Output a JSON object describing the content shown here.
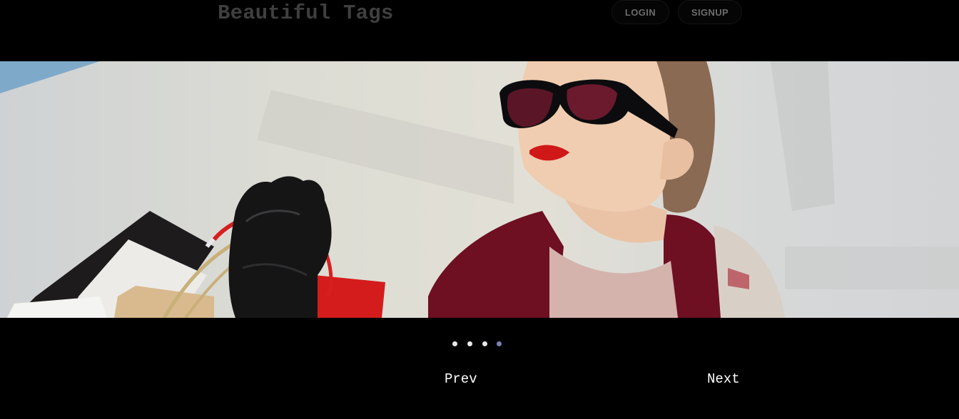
{
  "header": {
    "brand": "Beautiful Tags",
    "login_label": "LOGIN",
    "signup_label": "SIGNUP"
  },
  "carousel": {
    "slide_count": 4,
    "active_index": 3,
    "prev_label": "Prev",
    "next_label": "Next"
  },
  "colors": {
    "background": "#000000",
    "brand_text": "#3f3f3f",
    "indicator_inactive": "#e8e8ee",
    "indicator_active": "#7e7fb8",
    "nav_text": "#ffffff"
  }
}
